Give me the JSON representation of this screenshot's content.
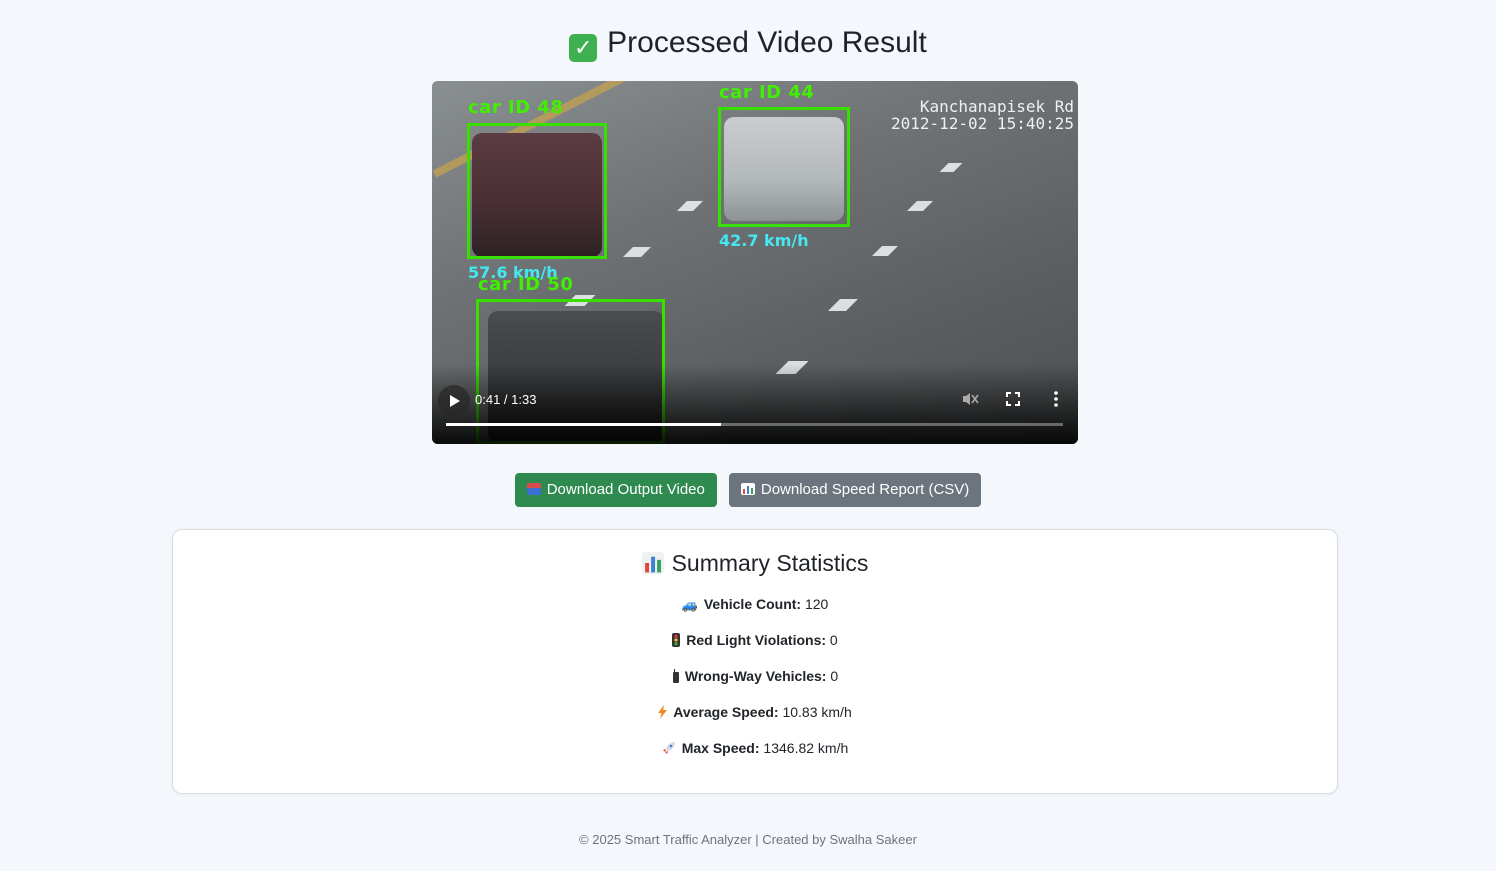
{
  "page": {
    "title": "Processed Video Result",
    "title_icon": "check-mark-box-icon"
  },
  "video": {
    "overlay_location": "Kanchanapisek Rd",
    "overlay_timestamp": "2012-12-02 15:40:25",
    "detections": [
      {
        "label": "car ID 48",
        "speed": "57.6 km/h"
      },
      {
        "label": "car ID 44",
        "speed": "42.7 km/h"
      },
      {
        "label": "car ID 50",
        "speed": ""
      }
    ],
    "time_display": "0:41 / 1:33",
    "progress_fraction": 0.445,
    "muted": true
  },
  "actions": {
    "download_video_label": "Download Output Video",
    "download_video_icon": "inbox-tray-icon",
    "download_csv_label": "Download Speed Report (CSV)",
    "download_csv_icon": "bar-chart-icon"
  },
  "summary": {
    "title": "Summary Statistics",
    "title_icon": "bar-chart-icon",
    "stats": [
      {
        "icon": "car-icon",
        "label": "Vehicle Count:",
        "value": "120"
      },
      {
        "icon": "traffic-light-icon",
        "label": "Red Light Violations:",
        "value": "0"
      },
      {
        "icon": "walkie-talkie-icon",
        "label": "Wrong-Way Vehicles:",
        "value": "0"
      },
      {
        "icon": "lightning-icon",
        "label": "Average Speed:",
        "value": "10.83 km/h"
      },
      {
        "icon": "rocket-icon",
        "label": "Max Speed:",
        "value": "1346.82 km/h"
      }
    ]
  },
  "footer": {
    "text": "© 2025 Smart Traffic Analyzer | Created by Swalha Sakeer"
  },
  "colors": {
    "background": "#f4f7fb",
    "bbox_green": "#38e000",
    "speed_cyan": "#45e8f0",
    "button_green": "#2f8a4f",
    "button_gray": "#6c757d"
  }
}
